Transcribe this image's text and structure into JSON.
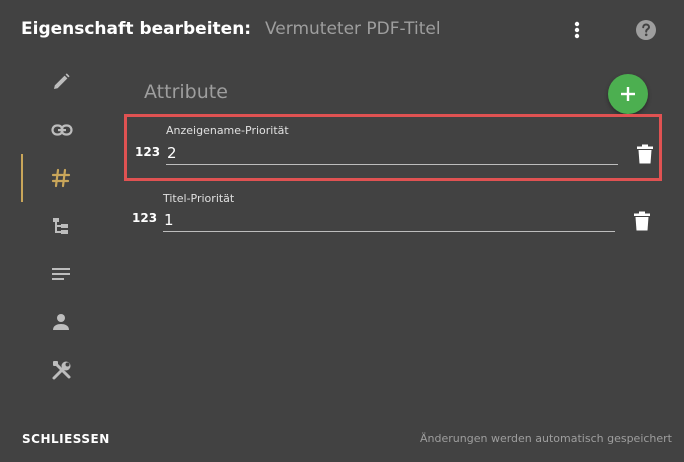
{
  "header": {
    "title_prefix": "Eigenschaft bearbeiten:",
    "title_name": "Vermuteter PDF-Titel",
    "menu_icon": "more-vert-icon",
    "help_icon": "help-icon"
  },
  "nav": {
    "items": [
      {
        "icon": "pencil-icon",
        "active": false
      },
      {
        "icon": "link-icon",
        "active": false
      },
      {
        "icon": "hash-icon",
        "active": true
      },
      {
        "icon": "tree-icon",
        "active": false
      },
      {
        "icon": "text-lines-icon",
        "active": false
      },
      {
        "icon": "person-icon",
        "active": false
      },
      {
        "icon": "tools-icon",
        "active": false
      }
    ],
    "active_color": "#c9a65a"
  },
  "section": {
    "title": "Attribute",
    "add_icon": "plus-icon"
  },
  "attributes": [
    {
      "type_badge": "123",
      "label": "Anzeigename-Priorität",
      "value": "2",
      "highlighted": true
    },
    {
      "type_badge": "123",
      "label": "Titel-Priorität",
      "value": "1",
      "highlighted": false
    }
  ],
  "footer": {
    "close_label": "SCHLIESSEN",
    "autosave_note": "Änderungen werden automatisch gespeichert"
  },
  "colors": {
    "background": "#424242",
    "accent_green": "#4caf50",
    "highlight_red": "#e05252"
  }
}
